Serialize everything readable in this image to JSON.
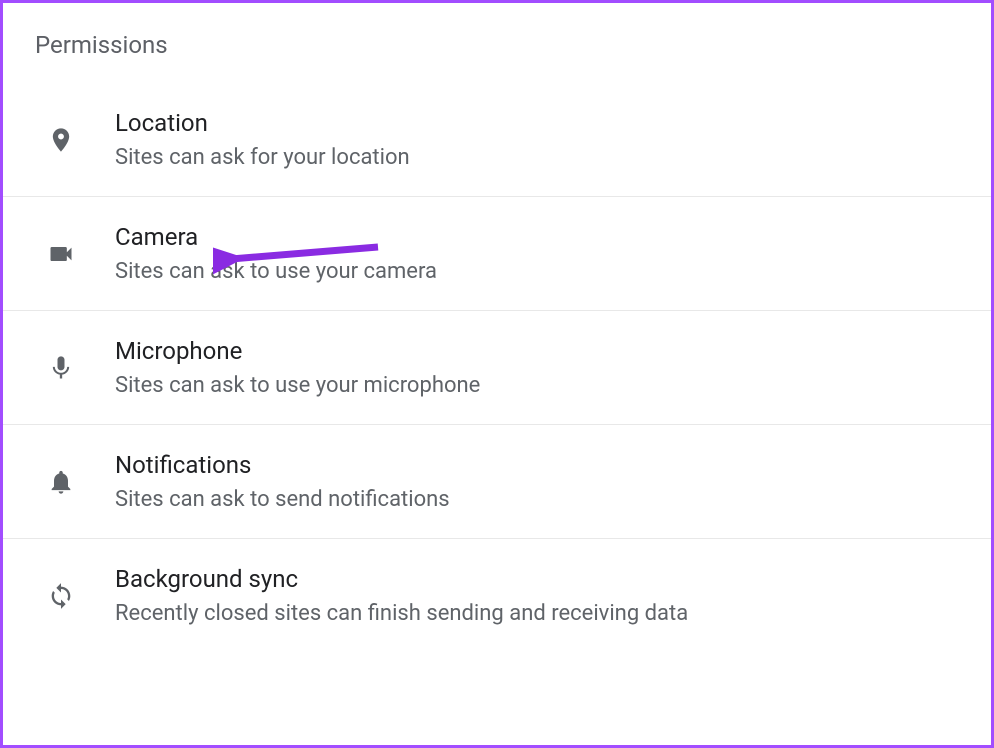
{
  "section": {
    "title": "Permissions"
  },
  "permissions": [
    {
      "icon": "location",
      "title": "Location",
      "description": "Sites can ask for your location"
    },
    {
      "icon": "camera",
      "title": "Camera",
      "description": "Sites can ask to use your camera"
    },
    {
      "icon": "microphone",
      "title": "Microphone",
      "description": "Sites can ask to use your microphone"
    },
    {
      "icon": "notifications",
      "title": "Notifications",
      "description": "Sites can ask to send notifications"
    },
    {
      "icon": "sync",
      "title": "Background sync",
      "description": "Recently closed sites can finish sending and receiving data"
    }
  ],
  "annotation": {
    "color": "#8a2be2",
    "target": "camera"
  }
}
